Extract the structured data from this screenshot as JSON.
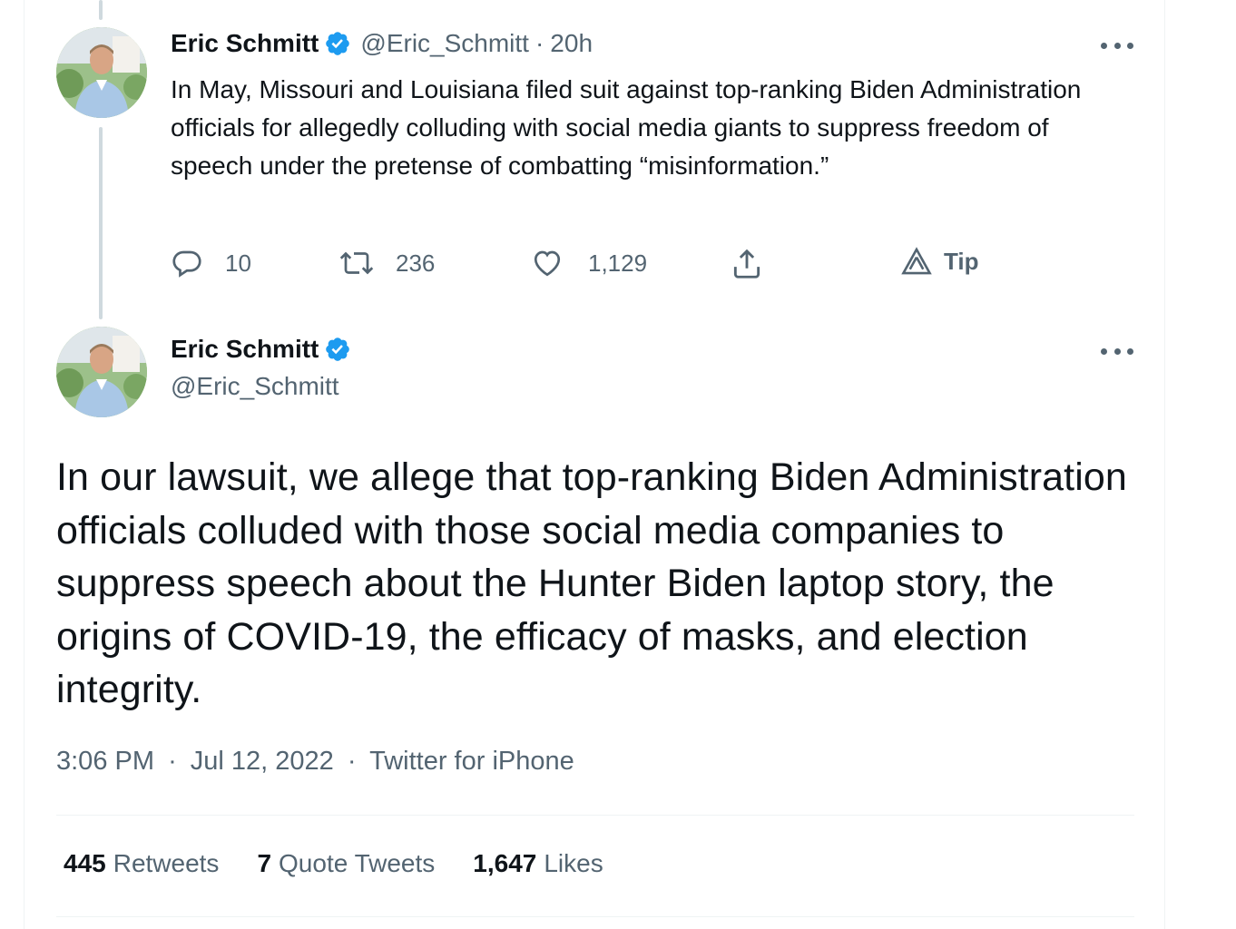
{
  "colors": {
    "text_primary": "#0f1419",
    "text_secondary": "#536471",
    "verified_blue": "#1d9bf0",
    "divider": "#eff3f4"
  },
  "reply_tweet": {
    "author_name": "Eric Schmitt",
    "author_handle": "@Eric_Schmitt",
    "separator": "·",
    "time_ago": "20h",
    "text": "In May, Missouri and Louisiana filed suit against top-ranking Biden Administration officials for allegedly colluding with social media giants to suppress freedom of speech under the pretense of combatting “misinformation.”",
    "actions": {
      "reply_count": "10",
      "retweet_count": "236",
      "like_count": "1,129",
      "tip_label": "Tip"
    },
    "icons": [
      "verified-badge-icon",
      "more-icon",
      "reply-icon",
      "retweet-icon",
      "like-icon",
      "share-icon",
      "tip-icon"
    ]
  },
  "main_tweet": {
    "author_name": "Eric Schmitt",
    "author_handle": "@Eric_Schmitt",
    "text": "In our lawsuit, we allege that top-ranking Biden Administration officials colluded with those social media companies to suppress speech about the Hunter Biden laptop story, the origins of COVID-19, the efficacy of masks, and election integrity.",
    "time": "3:06 PM",
    "date": "Jul 12, 2022",
    "source": "Twitter for iPhone",
    "separator": "·",
    "stats": {
      "retweets_count": "445",
      "retweets_label": "Retweets",
      "quotes_count": "7",
      "quotes_label": "Quote Tweets",
      "likes_count": "1,647",
      "likes_label": "Likes"
    }
  }
}
